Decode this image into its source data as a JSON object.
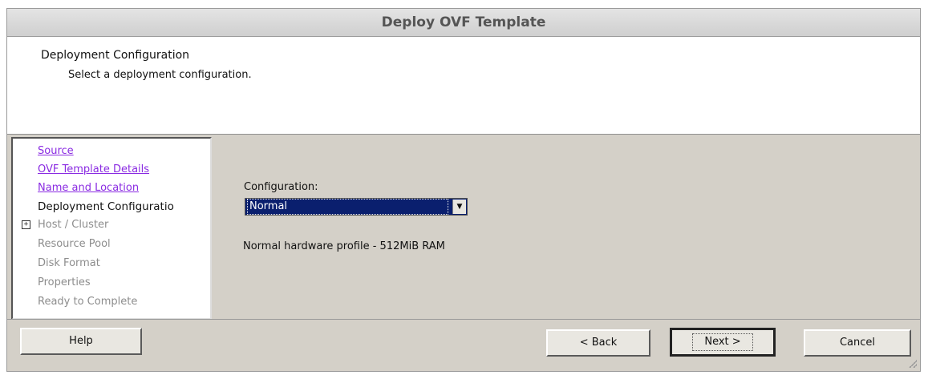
{
  "window": {
    "title": "Deploy OVF Template"
  },
  "header": {
    "title": "Deployment Configuration",
    "subtitle": "Select a deployment configuration."
  },
  "nav": {
    "items": [
      {
        "label": "Source",
        "state": "link"
      },
      {
        "label": "OVF Template Details",
        "state": "link"
      },
      {
        "label": "Name and Location",
        "state": "link"
      },
      {
        "label": "Deployment Configuratio",
        "state": "current"
      },
      {
        "label": "Host / Cluster",
        "state": "disabled",
        "expander": "+"
      },
      {
        "label": "Resource Pool",
        "state": "disabled"
      },
      {
        "label": "Disk Format",
        "state": "disabled"
      },
      {
        "label": "Properties",
        "state": "disabled"
      },
      {
        "label": "Ready to Complete",
        "state": "disabled"
      }
    ]
  },
  "content": {
    "configuration_label": "Configuration:",
    "configuration_value": "Normal",
    "description": "Normal hardware profile - 512MiB RAM"
  },
  "buttons": {
    "help": "Help",
    "back": "< Back",
    "next": "Next >",
    "cancel": "Cancel"
  },
  "icons": {
    "dropdown_arrow": "▼",
    "expander": "+"
  },
  "colors": {
    "link": "#8a2be2",
    "selection": "#0a1f6e",
    "dialog_bg": "#d4d0c8"
  }
}
